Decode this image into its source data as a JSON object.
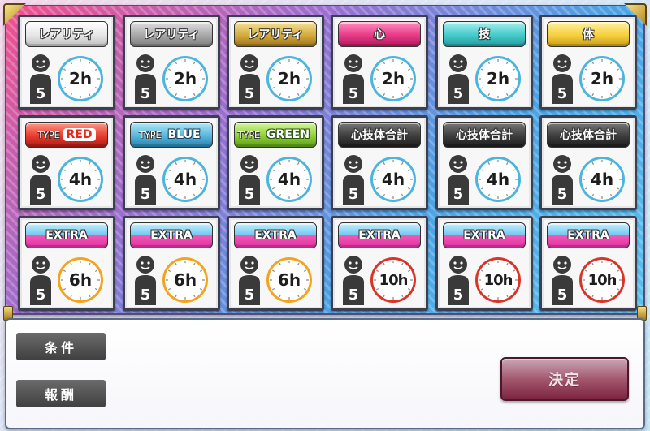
{
  "colors": {
    "board_frame_left": "#f14f8c",
    "board_frame_right": "#58c3ee",
    "slot_border": "#3b3f52",
    "person_silhouette": "#3a3a3a",
    "clock_blue": "#4cb5dd",
    "clock_orange": "#f3a41c",
    "clock_red": "#d8342a",
    "confirm_button": "#8c3150"
  },
  "slots": [
    {
      "tag": "レアリティ",
      "style": "silver",
      "people": "5",
      "duration": "2h",
      "clock": "blue"
    },
    {
      "tag": "レアリティ",
      "style": "silvergray",
      "people": "5",
      "duration": "2h",
      "clock": "blue"
    },
    {
      "tag": "レアリティ",
      "style": "gold",
      "people": "5",
      "duration": "2h",
      "clock": "blue"
    },
    {
      "tag": "心",
      "style": "pink",
      "people": "5",
      "duration": "2h",
      "clock": "blue"
    },
    {
      "tag": "技",
      "style": "teal",
      "people": "5",
      "duration": "2h",
      "clock": "blue"
    },
    {
      "tag": "体",
      "style": "yellow",
      "people": "5",
      "duration": "2h",
      "clock": "blue"
    },
    {
      "tag_prefix": "TYPE",
      "tag": "RED",
      "style": "typered",
      "people": "5",
      "duration": "4h",
      "clock": "blue"
    },
    {
      "tag_prefix": "TYPE",
      "tag": "BLUE",
      "style": "typeblue",
      "people": "5",
      "duration": "4h",
      "clock": "blue"
    },
    {
      "tag_prefix": "TYPE",
      "tag": "GREEN",
      "style": "typegreen",
      "people": "5",
      "duration": "4h",
      "clock": "blue"
    },
    {
      "tag": "心技体合計",
      "style": "black",
      "people": "5",
      "duration": "4h",
      "clock": "blue"
    },
    {
      "tag": "心技体合計",
      "style": "black",
      "people": "5",
      "duration": "4h",
      "clock": "blue"
    },
    {
      "tag": "心技体合計",
      "style": "black",
      "people": "5",
      "duration": "4h",
      "clock": "blue"
    },
    {
      "tag": "EXTRA",
      "style": "extra",
      "people": "5",
      "duration": "6h",
      "clock": "orange"
    },
    {
      "tag": "EXTRA",
      "style": "extra",
      "people": "5",
      "duration": "6h",
      "clock": "orange"
    },
    {
      "tag": "EXTRA",
      "style": "extra",
      "people": "5",
      "duration": "6h",
      "clock": "orange"
    },
    {
      "tag": "EXTRA",
      "style": "extra",
      "people": "5",
      "duration": "10h",
      "clock": "red"
    },
    {
      "tag": "EXTRA",
      "style": "extra",
      "people": "5",
      "duration": "10h",
      "clock": "red"
    },
    {
      "tag": "EXTRA",
      "style": "extra",
      "people": "5",
      "duration": "10h",
      "clock": "red"
    }
  ],
  "panel": {
    "condition_label": "条件",
    "reward_label": "報酬",
    "confirm_label": "決定"
  }
}
